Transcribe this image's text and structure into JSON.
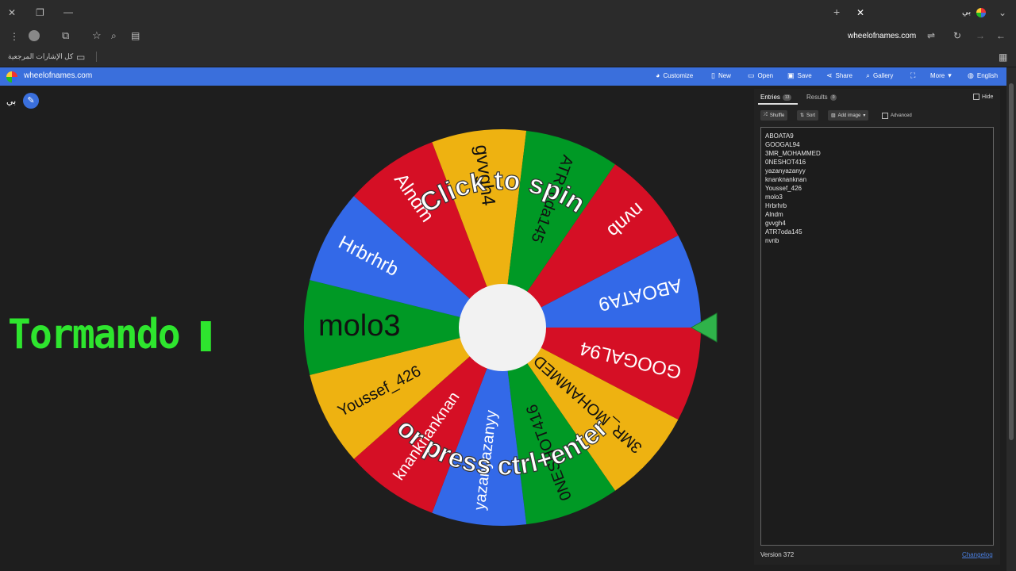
{
  "browser": {
    "tab_title": "بي",
    "url": "wheelofnames.com",
    "bookmarks_label": "كل الإشارات المرجعية"
  },
  "appbar": {
    "site": "wheelofnames.com",
    "menu": [
      {
        "label": "Customize",
        "icon": "palette-icon"
      },
      {
        "label": "New",
        "icon": "file-icon"
      },
      {
        "label": "Open",
        "icon": "folder-icon"
      },
      {
        "label": "Save",
        "icon": "save-icon"
      },
      {
        "label": "Share",
        "icon": "share-icon"
      },
      {
        "label": "Gallery",
        "icon": "search-icon"
      },
      {
        "label": "",
        "icon": "fullscreen-icon"
      },
      {
        "label": "More",
        "icon": "chevron-down-icon"
      },
      {
        "label": "English",
        "icon": "globe-icon"
      }
    ]
  },
  "wheel_title": "بي",
  "wheel": {
    "center_text_1": "Click to spin",
    "center_text_2": "or press ctrl+enter",
    "segments": [
      {
        "name": "ABOATA9",
        "color": "#3369e8"
      },
      {
        "name": "GOOGAL94",
        "color": "#d50f25"
      },
      {
        "name": "3MR_MOHAMMED",
        "color": "#eeb211"
      },
      {
        "name": "0NESHOT416",
        "color": "#009925"
      },
      {
        "name": "yazanyazanyy",
        "color": "#3369e8"
      },
      {
        "name": "knanknanknan",
        "color": "#d50f25"
      },
      {
        "name": "Youssef_426",
        "color": "#eeb211"
      },
      {
        "name": "molo3",
        "color": "#009925"
      },
      {
        "name": "Hrbrhrb",
        "color": "#3369e8"
      },
      {
        "name": "Alndm",
        "color": "#d50f25"
      },
      {
        "name": "gvvgh4",
        "color": "#eeb211"
      },
      {
        "name": "ATR7oda145",
        "color": "#009925"
      },
      {
        "name": "nvnb",
        "color": "#d50f25"
      }
    ]
  },
  "overlay_text": "Tormando",
  "sidebar": {
    "tab_entries": "Entries",
    "entries_count": "13",
    "tab_results": "Results",
    "results_count": "0",
    "hide_label": "Hide",
    "shuffle_label": "Shuffle",
    "sort_label": "Sort",
    "add_image_label": "Add image",
    "advanced_label": "Advanced",
    "entries": [
      "ABOATA9",
      "GOOGAL94",
      "3MR_MOHAMMED",
      "0NESHOT416",
      "yazanyazanyy",
      "knanknanknan",
      "Youssef_426",
      "molo3",
      "Hrbrhrb",
      "Alndm",
      "gvvgh4",
      "ATR7oda145",
      "nvnb"
    ],
    "version": "Version 372",
    "changelog": "Changelog"
  }
}
